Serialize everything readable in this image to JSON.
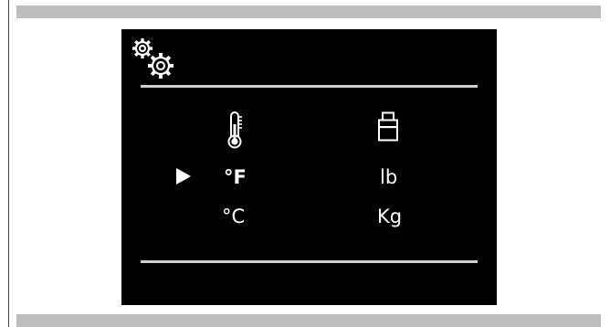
{
  "icons": {
    "settings": "settings-gears-icon",
    "temperature": "thermometer-icon",
    "weight": "weight-icon",
    "cursor": "selection-arrow-icon"
  },
  "temperature": {
    "options": [
      "°F",
      "°C"
    ],
    "selected": "°F"
  },
  "weight": {
    "options": [
      "lb",
      "Kg"
    ]
  },
  "colors": {
    "screen_bg": "#000000",
    "foreground": "#ffffff",
    "divider": "#cfcfcf",
    "frame_band": "#bdbdbd"
  }
}
